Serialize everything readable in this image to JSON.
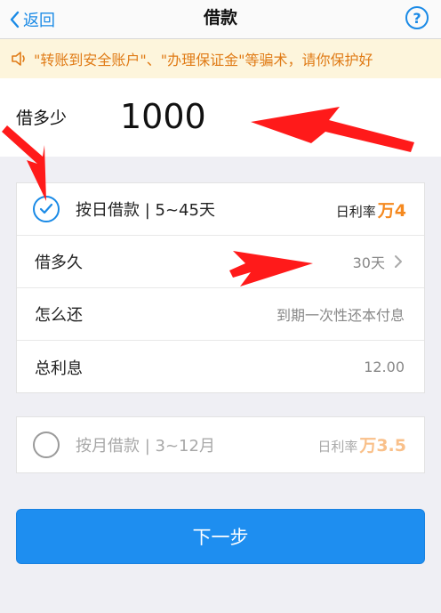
{
  "nav": {
    "back_label": "返回",
    "title": "借款",
    "help_label": "?"
  },
  "notice": {
    "text": "\"转账到安全账户\"、\"办理保证金\"等骗术，请你保护好"
  },
  "amount": {
    "label": "借多少",
    "value": "1000"
  },
  "daily_plan": {
    "label": "按日借款 | 5~45天",
    "rate_label": "日利率",
    "rate_value": "万4",
    "selected": true,
    "rows": [
      {
        "label": "借多久",
        "value": "30天"
      },
      {
        "label": "怎么还",
        "value": "到期一次性还本付息"
      },
      {
        "label": "总利息",
        "value": "12.00"
      }
    ]
  },
  "monthly_plan": {
    "label": "按月借款 | 3~12月",
    "rate_label": "日利率",
    "rate_value": "万3.5",
    "selected": false
  },
  "next_button": {
    "label": "下一步"
  },
  "colors": {
    "accent": "#1e8ef0",
    "rate": "#f5891f",
    "notice_text": "#e07b16",
    "annotation": "#ff1a1a"
  }
}
